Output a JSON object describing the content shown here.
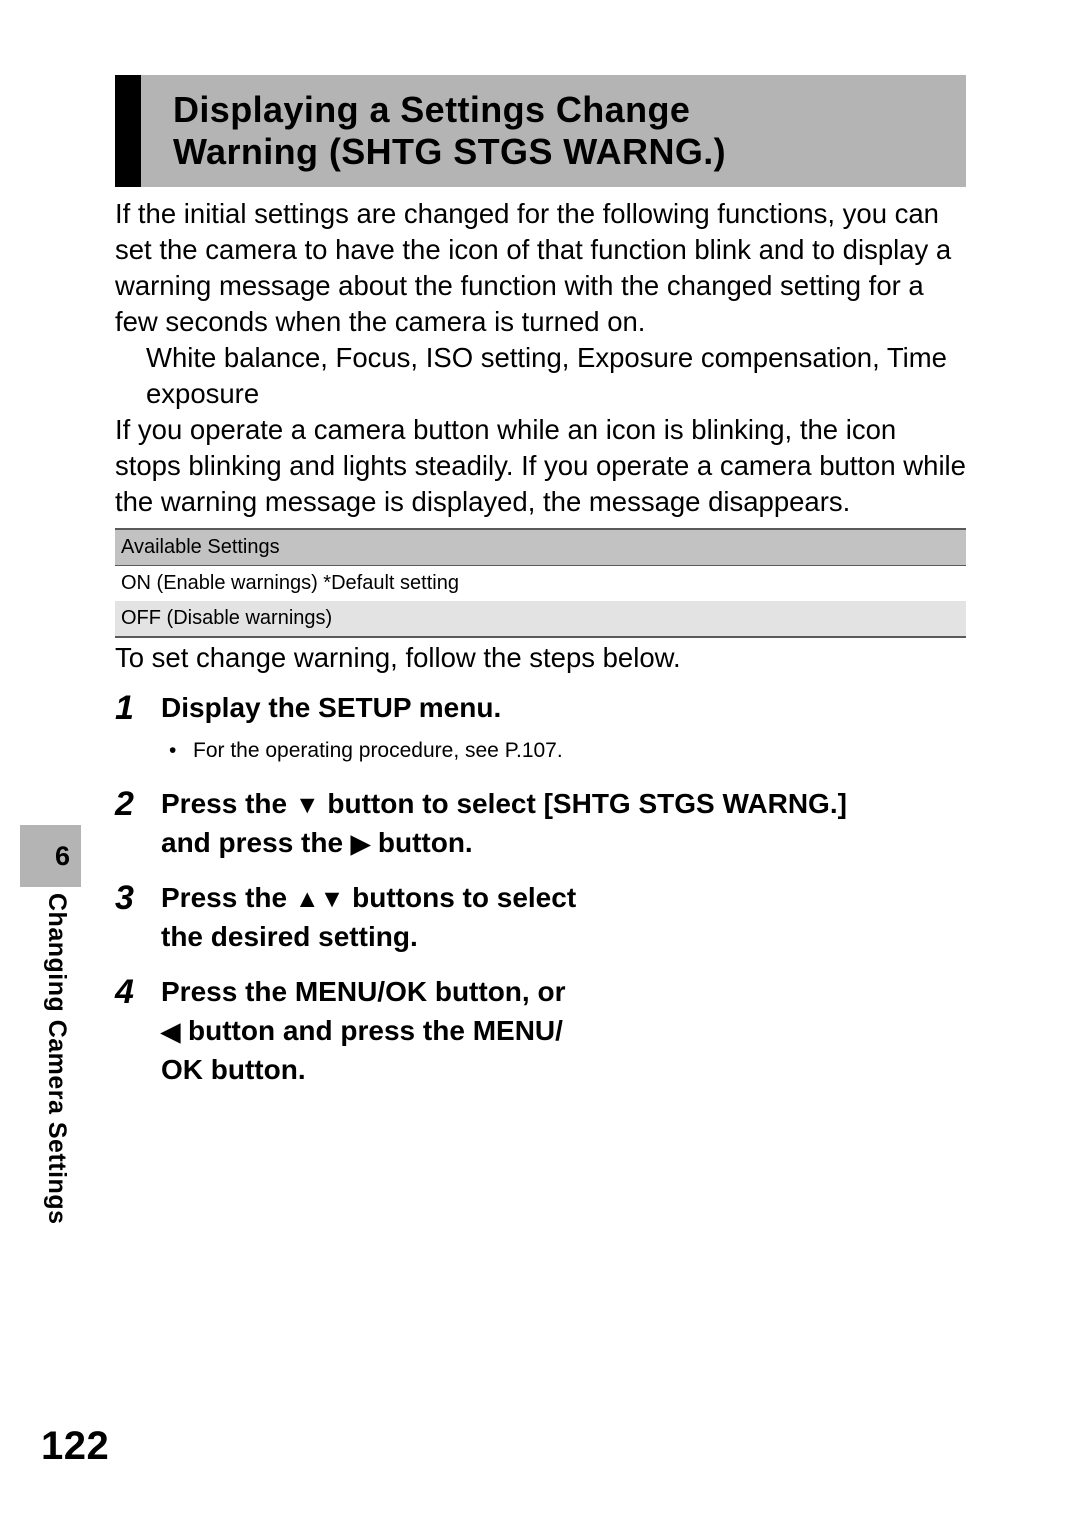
{
  "header": {
    "title_line1": "Displaying a Settings Change",
    "title_line2": "Warning (SHTG STGS WARNG.)"
  },
  "body": {
    "paragraph1": "If the initial settings are changed for the following functions, you can set the camera to have the icon of that function blink and to display a warning message about the function with the changed setting for a few seconds when the camera is turned on.",
    "function_list": "White balance, Focus, ISO setting, Exposure compensation, Time exposure",
    "paragraph2": "If you operate a camera button while an icon is blinking, the icon stops blinking and lights steadily. If you operate a camera button while the warning message is displayed, the message disappears.",
    "steps_intro": "To set change warning, follow the steps below."
  },
  "settings_table": {
    "header": "Available Settings",
    "rows": [
      "ON (Enable warnings) *Default setting",
      "OFF (Disable warnings)"
    ]
  },
  "steps": [
    {
      "number": "1",
      "line1": "Display the SETUP menu.",
      "bullet": "•",
      "note": "For the operating procedure, see P.107."
    },
    {
      "number": "2",
      "line1_pre": "Press the ",
      "glyph1": "▼",
      "line1_post": " button to select [SHTG STGS WARNG.]",
      "line2_pre": "and press the ",
      "glyph2": "▶",
      "line2_post": " button."
    },
    {
      "number": "3",
      "line1_pre": "Press the ",
      "glyph1": "▲▼",
      "line1_post": " buttons to select",
      "line2": "the desired setting."
    },
    {
      "number": "4",
      "line1": "Press the MENU/OK button, or",
      "glyph1": "◀",
      "line2_post": " button and press the MENU/",
      "line3": "OK button."
    }
  ],
  "chapter": {
    "number": "6",
    "label": "Changing Camera Settings"
  },
  "footer": {
    "page_number": "122"
  },
  "colors": {
    "band_gray": "#b4b4b4",
    "table_header_gray": "#c2c2c2",
    "table_alt_gray": "#e3e3e3",
    "rule": "#5a5a5a"
  }
}
